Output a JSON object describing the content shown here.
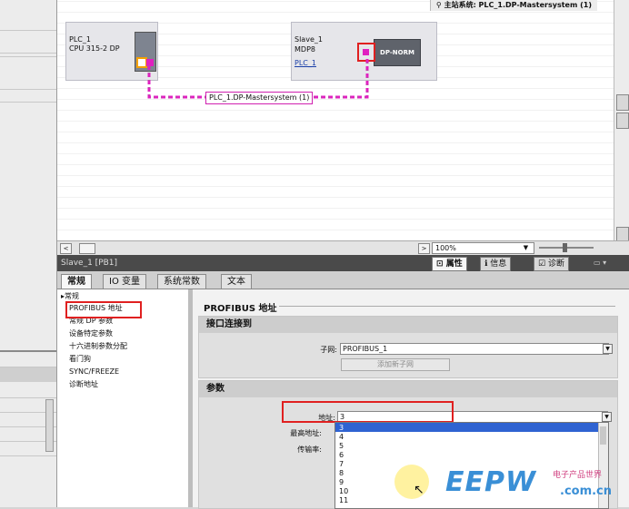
{
  "canvas": {
    "top_right_label": "主站系统: PLC_1.DP-Mastersystem (1)",
    "plc": {
      "name": "PLC_1",
      "model": "CPU 315-2 DP"
    },
    "slave": {
      "name": "Slave_1",
      "type": "MDP8",
      "link": "PLC_1",
      "module": "DP-NORM"
    },
    "bus_label": "PLC_1.DP-Mastersystem (1)",
    "bus_color": "#e020c0"
  },
  "toolbar": {
    "zoom": "100%"
  },
  "properties": {
    "title": "Slave_1 [PB1]",
    "tabs": [
      "属性",
      "信息",
      "诊断"
    ],
    "active_tab": "属性"
  },
  "tabs": [
    "常规",
    "IO 变量",
    "系统常数",
    "文本"
  ],
  "nav": {
    "items": [
      "常规",
      "PROFIBUS 地址",
      "常规 DP 参数",
      "设备特定参数",
      "十六进制参数分配",
      "看门狗",
      "SYNC/FREEZE",
      "诊断地址"
    ]
  },
  "content": {
    "section_title": "PROFIBUS 地址",
    "interface": {
      "title": "接口连接到",
      "subnet_label": "子网:",
      "subnet_value": "PROFIBUS_1",
      "add_subnet": "添加新子网"
    },
    "params": {
      "title": "参数",
      "address_label": "地址:",
      "address_value": "3",
      "highest_label": "最高地址:",
      "rate_label": "传输率:"
    },
    "dropdown_options": [
      "3",
      "4",
      "5",
      "6",
      "7",
      "8",
      "9",
      "10",
      "11"
    ]
  },
  "watermark": {
    "main": "EEPW",
    "sub": "电子产品世界",
    "com": ".com.cn"
  },
  "colors": {
    "highlight": "#e02020",
    "accent": "#2f63d1"
  }
}
